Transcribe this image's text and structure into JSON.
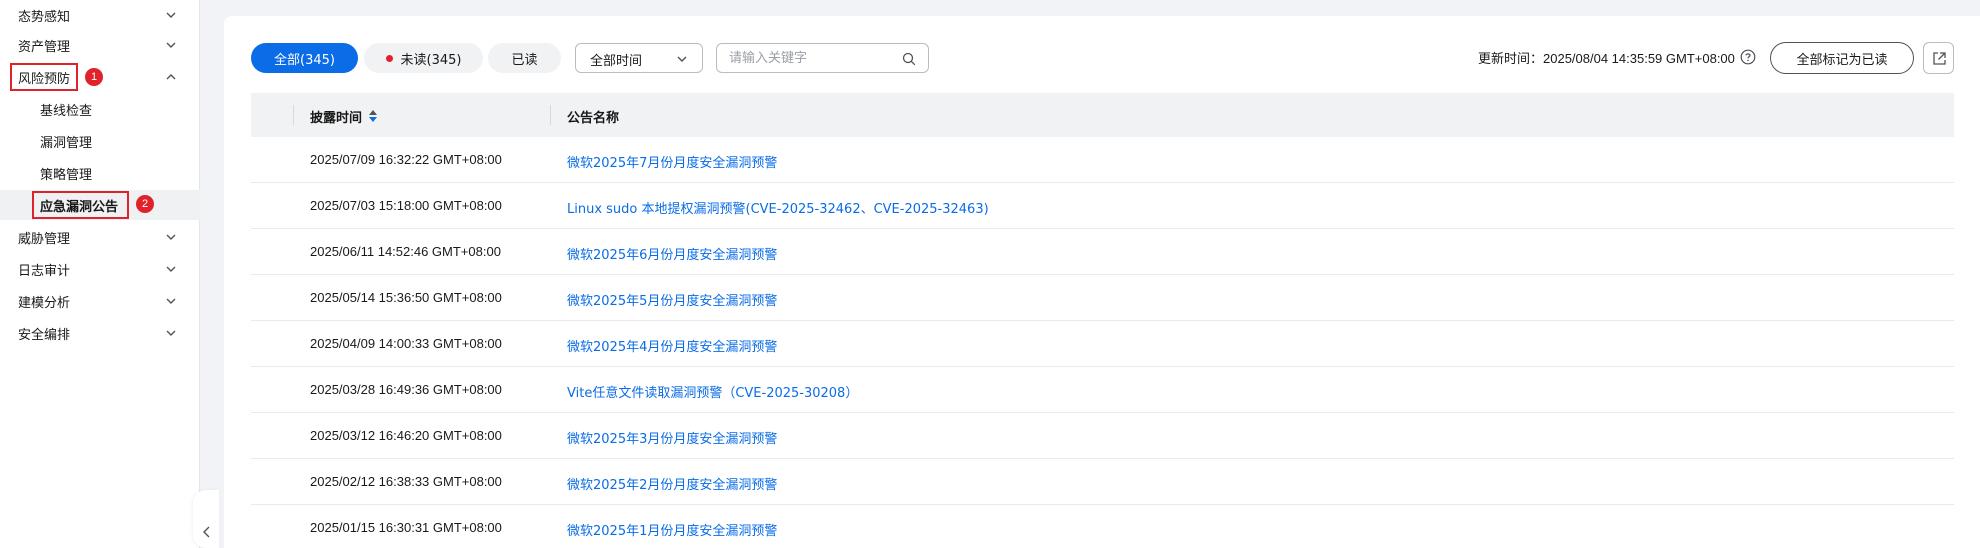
{
  "sidebar": {
    "items": [
      {
        "label": "态势感知",
        "expanded": false
      },
      {
        "label": "资产管理",
        "expanded": false
      },
      {
        "label": "风险预防",
        "expanded": true
      },
      {
        "label": "基线检查"
      },
      {
        "label": "漏洞管理"
      },
      {
        "label": "策略管理"
      },
      {
        "label": "应急漏洞公告",
        "active": true
      },
      {
        "label": "威胁管理",
        "expanded": false
      },
      {
        "label": "日志审计",
        "expanded": false
      },
      {
        "label": "建模分析",
        "expanded": false
      },
      {
        "label": "安全编排",
        "expanded": false
      }
    ],
    "step_badges": [
      "1",
      "2"
    ],
    "annotation_color": "#e0232b"
  },
  "toolbar": {
    "tabs": [
      {
        "label": "全部(345)",
        "active": true
      },
      {
        "label": "未读(345)",
        "active": false,
        "dot": true
      },
      {
        "label": "已读",
        "active": false
      }
    ],
    "time_filter": "全部时间",
    "search_placeholder": "请输入关键字",
    "update_time": "更新时间：2025/08/04 14:35:59 GMT+08:00",
    "mark_all_read": "全部标记为已读",
    "accent": "#0a6ce6"
  },
  "table": {
    "columns": [
      "披露时间",
      "公告名称"
    ],
    "sort_icon": "sort-up-down-icon",
    "rows": [
      {
        "time": "2025/07/09 16:32:22 GMT+08:00",
        "name": "微软2025年7月份月度安全漏洞预警"
      },
      {
        "time": "2025/07/03 15:18:00 GMT+08:00",
        "name": "Linux sudo 本地提权漏洞预警(CVE-2025-32462、CVE-2025-32463)"
      },
      {
        "time": "2025/06/11 14:52:46 GMT+08:00",
        "name": "微软2025年6月份月度安全漏洞预警"
      },
      {
        "time": "2025/05/14 15:36:50 GMT+08:00",
        "name": "微软2025年5月份月度安全漏洞预警"
      },
      {
        "time": "2025/04/09 14:00:33 GMT+08:00",
        "name": "微软2025年4月份月度安全漏洞预警"
      },
      {
        "time": "2025/03/28 16:49:36 GMT+08:00",
        "name": "Vite任意文件读取漏洞预警（CVE-2025-30208）"
      },
      {
        "time": "2025/03/12 16:46:20 GMT+08:00",
        "name": "微软2025年3月份月度安全漏洞预警"
      },
      {
        "time": "2025/02/12 16:38:33 GMT+08:00",
        "name": "微软2025年2月份月度安全漏洞预警"
      },
      {
        "time": "2025/01/15 16:30:31 GMT+08:00",
        "name": "微软2025年1月份月度安全漏洞预警"
      }
    ]
  }
}
